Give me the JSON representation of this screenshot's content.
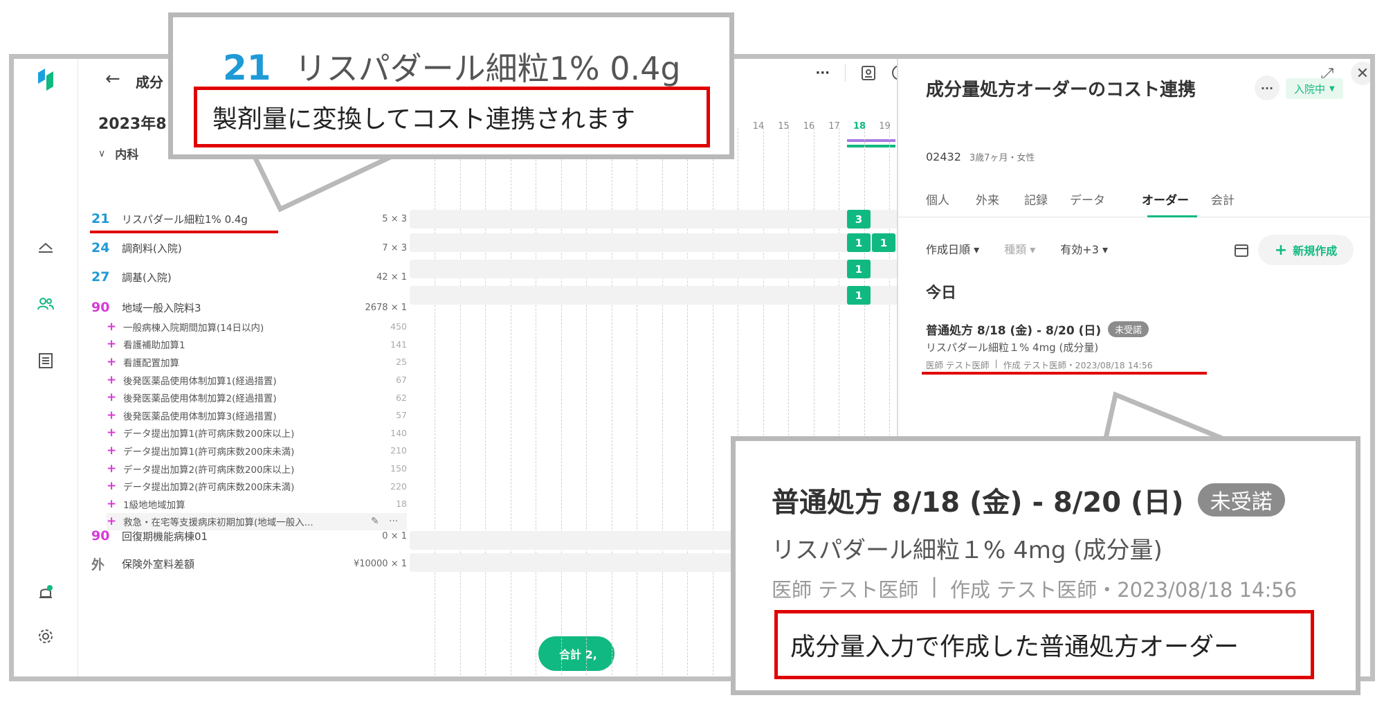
{
  "header": {
    "back_icon": "arrow-left-icon",
    "title_partial": "成分",
    "date_partial": "2023年8"
  },
  "toolbar": {
    "more": "···"
  },
  "sidebar": {
    "icons": [
      "logo-icon",
      "bed-icon",
      "users-icon",
      "list-icon",
      "bell-icon",
      "gear-icon"
    ],
    "bell_dot_color": "#10b981"
  },
  "list": {
    "group": "内科",
    "rows": [
      {
        "code": "21",
        "name": "リスパダール細粒1% 0.4g",
        "count": "5 × 3",
        "color": "#1e9ad6"
      },
      {
        "code": "24",
        "name": "調剤料(入院)",
        "count": "7 × 3",
        "color": "#1e9ad6"
      },
      {
        "code": "27",
        "name": "調基(入院)",
        "count": "42 × 1",
        "color": "#1e9ad6"
      },
      {
        "code": "90",
        "name": "地域一般入院料3",
        "count": "2678 × 1",
        "color": "#d63ad6"
      }
    ],
    "subitems": [
      {
        "name": "一般病棟入院期間加算(14日以内)",
        "value": "450"
      },
      {
        "name": "看護補助加算1",
        "value": "141"
      },
      {
        "name": "看護配置加算",
        "value": "25"
      },
      {
        "name": "後発医薬品使用体制加算1(経過措置)",
        "value": "67"
      },
      {
        "name": "後発医薬品使用体制加算2(経過措置)",
        "value": "62"
      },
      {
        "name": "後発医薬品使用体制加算3(経過措置)",
        "value": "57"
      },
      {
        "name": "データ提出加算1(許可病床数200床以上)",
        "value": "140"
      },
      {
        "name": "データ提出加算1(許可病床数200床未満)",
        "value": "210"
      },
      {
        "name": "データ提出加算2(許可病床数200床以上)",
        "value": "150"
      },
      {
        "name": "データ提出加算2(許可病床数200床未満)",
        "value": "220"
      },
      {
        "name": "1級地地域加算",
        "value": "18"
      },
      {
        "name": "救急・在宅等支援病床初期加算(地域一般入...",
        "value": ""
      }
    ],
    "rows2": [
      {
        "code": "90",
        "name": "回復期機能病棟01",
        "count": "0 × 1",
        "color": "#d63ad6"
      },
      {
        "code": "外",
        "name": "保険外室料差額",
        "count": "¥10000 × 1",
        "color": "#777"
      }
    ]
  },
  "timeline": {
    "days": [
      "14",
      "15",
      "16",
      "17",
      "18",
      "19"
    ],
    "today": "18",
    "chips": {
      "r1": "3",
      "r2a": "1",
      "r2b": "1",
      "r3": "1",
      "r4": "1"
    },
    "total_partial": "合計 2,"
  },
  "panel": {
    "title": "成分量処方オーダーのコスト連携",
    "status": "入院中",
    "patient_id": "02432",
    "patient_info": "3歳7ヶ月・女性",
    "tabs": [
      "個人",
      "外来",
      "記録",
      "データ",
      "オーダー",
      "会計"
    ],
    "active_tab": "オーダー",
    "filters": {
      "sort": "作成日順",
      "type": "種類",
      "valid": "有効+3"
    },
    "new_button": "新規作成",
    "section": "今日",
    "order": {
      "title": "普通処方  8/18 (金) - 8/20 (日)",
      "badge": "未受諾",
      "drug": "リスパダール細粒１% 4mg (成分量)",
      "doctor": "医師 テスト医師",
      "created": "作成 テスト医師・2023/08/18 14:56"
    }
  },
  "callout_top": {
    "code": "21",
    "name": "リスパダール細粒1% 0.4g",
    "note": "製剤量に変換してコスト連携されます"
  },
  "callout_bottom": {
    "title": "普通処方  8/18 (金) - 8/20 (日)",
    "badge": "未受諾",
    "drug": "リスパダール細粒１% 4mg (成分量)",
    "doctor": "医師 テスト医師",
    "created": "作成 テスト医師・2023/08/18 14:56",
    "note": "成分量入力で作成した普通処方オーダー"
  }
}
